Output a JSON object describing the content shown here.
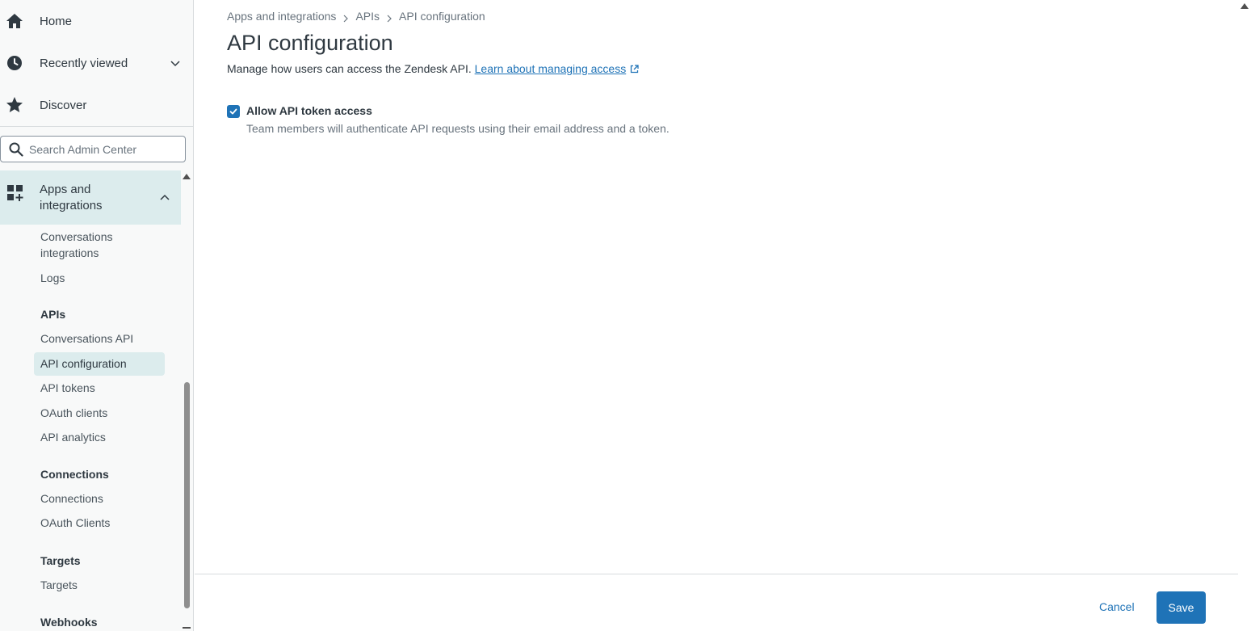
{
  "sidebar": {
    "nav": [
      {
        "label": "Home",
        "icon": "home-icon"
      },
      {
        "label": "Recently viewed",
        "icon": "clock-icon"
      },
      {
        "label": "Discover",
        "icon": "star-icon"
      }
    ],
    "search": {
      "placeholder": "Search Admin Center",
      "value": ""
    },
    "section": {
      "label": "Apps and integrations",
      "icon": "apps-add-icon"
    },
    "items": {
      "conversations_integrations": "Conversations integrations",
      "logs": "Logs",
      "apis_group": "APIs",
      "conversations_api": "Conversations API",
      "api_configuration": "API configuration",
      "api_tokens": "API tokens",
      "oauth_clients": "OAuth clients",
      "api_analytics": "API analytics",
      "connections_group": "Connections",
      "connections": "Connections",
      "oauth_clients_caps": "OAuth Clients",
      "targets_group": "Targets",
      "targets": "Targets",
      "webhooks_group": "Webhooks"
    }
  },
  "breadcrumb": [
    "Apps and integrations",
    "APIs",
    "API configuration"
  ],
  "page": {
    "title": "API configuration",
    "description": "Manage how users can access the Zendesk API.",
    "learn_link": "Learn about managing access",
    "option": {
      "label": "Allow API token access",
      "hint": "Team members will authenticate API requests using their email address and a token.",
      "checked": true
    }
  },
  "footer": {
    "cancel_label": "Cancel",
    "save_label": "Save"
  },
  "colors": {
    "accent": "#1f73b7",
    "active_bg": "#dceced",
    "sidebar_bg": "#f8f9f9"
  }
}
